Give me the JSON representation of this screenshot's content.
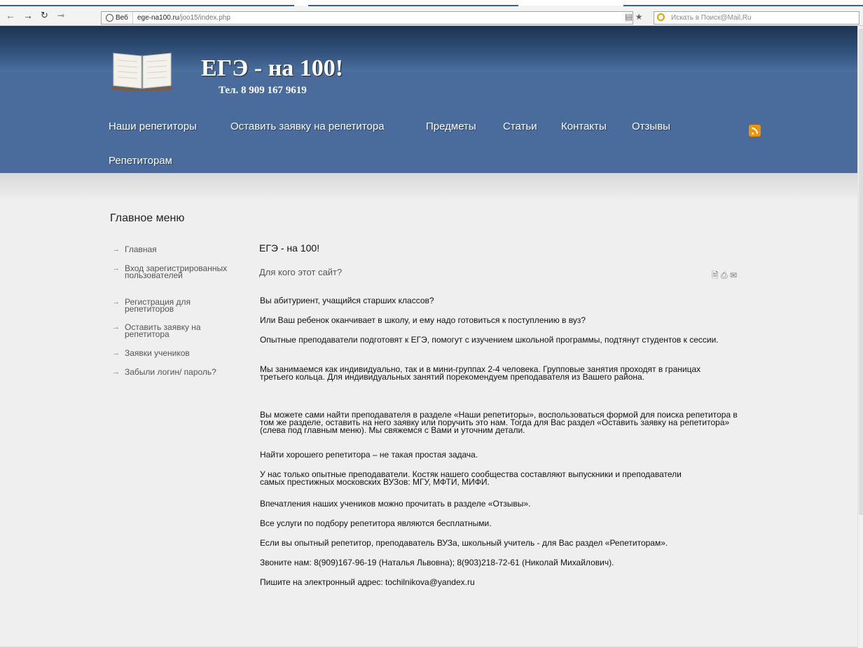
{
  "browser": {
    "back_icon": "arrow-left-icon",
    "forward_icon": "arrow-right-icon",
    "reload_icon": "reload-icon",
    "key_icon": "key-icon",
    "address_prefix": "Веб",
    "url_host": "ege-na100.ru",
    "url_path": "/joo15/index.php",
    "search_placeholder": "Искать в Поиск@Mail.Ru"
  },
  "header": {
    "title": "ЕГЭ - на 100!",
    "phone": "Тел. 8 909 167 9619",
    "nav": [
      "Наши репетиторы",
      "Оставить заявку на репетитора",
      "Предметы",
      "Статьи",
      "Контакты",
      "Отзывы",
      "Репетиторам"
    ],
    "rss_icon": "rss-icon"
  },
  "sidebar": {
    "title": "Главное меню",
    "items": [
      {
        "label": "Главная"
      },
      {
        "label": "Вход зарегистрированных пользователей"
      },
      {
        "label": "Регистрация для репетиторов"
      },
      {
        "label": "Оставить заявку на репетитора"
      },
      {
        "label": "Заявки учеников"
      },
      {
        "label": "Забыли логин/ пароль?"
      }
    ]
  },
  "article": {
    "title": "ЕГЭ - на 100!",
    "subtitle": "Для кого этот сайт?",
    "paragraphs": [
      "Вы абитуриент, учащийся старших классов?",
      "Или Ваш ребенок оканчивает в школу, и ему надо готовиться к поступлению в вуз?",
      "Опытные преподаватели подготовят к ЕГЭ, помогут с изучением школьной программы, подтянут студентов к сессии.",
      "Мы занимаемся как индивидуально, так и в мини-группах 2-4 человека. Групповые  занятия проходят в границах третьего кольца. Для индивидуальных занятий порекомендуем преподавателя из Вашего района.",
      "Вы можете сами найти преподавателя в разделе «Наши репетиторы», воспользоваться формой для поиска репетитора в том же разделе, оставить на него заявку или поручить это нам. Тогда для Вас раздел «Оставить заявку на репетитора» (слева под главным меню). Мы свяжемся с Вами и уточним детали.",
      "Найти хорошего репетитора – не такая простая задача.",
      "У нас только опытные преподаватели. Костяк нашего сообщества составляют выпускники и преподаватели самых престижных московских ВУЗов: МГУ, МФТИ, МИФИ.",
      "Впечатления наших учеников можно прочитать в разделе «Отзывы».",
      "Все услуги по подбору репетитора являются бесплатными.",
      "Если вы опытный репетитор, преподаватель ВУЗа, школьный учитель - для Вас раздел «Репетиторам».",
      "Звоните нам: 8(909)167-96-19 (Наталья Львовна); 8(903)218-72-61 (Николай Михайлович).",
      "Пишите на электронный адрес: tochilnikova@yandex.ru"
    ],
    "tools": [
      "pdf-icon",
      "print-icon",
      "email-icon"
    ]
  }
}
